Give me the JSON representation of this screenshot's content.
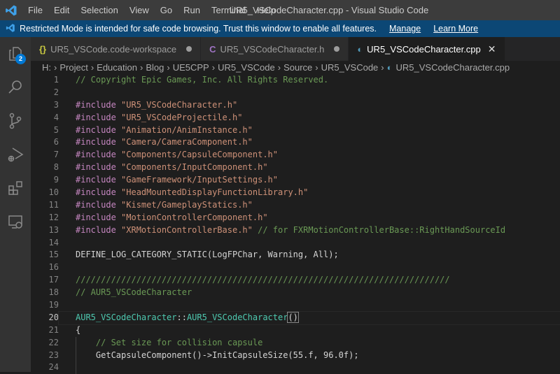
{
  "menu": [
    "File",
    "Edit",
    "Selection",
    "View",
    "Go",
    "Run",
    "Terminal",
    "Help"
  ],
  "window_title": "UR5_VSCodeCharacter.cpp - Visual Studio Code",
  "banner": {
    "text": "Restricted Mode is intended for safe code browsing. Trust this window to enable all features.",
    "manage": "Manage",
    "learn_more": "Learn More"
  },
  "activity": {
    "explorer_badge": "2"
  },
  "tabs": [
    {
      "icon": "{}",
      "label": "UR5_VSCode.code-workspace",
      "dirty": true,
      "color": "#cbcb41"
    },
    {
      "icon": "C",
      "label": "UR5_VSCodeCharacter.h",
      "dirty": true,
      "color": "#a074c4"
    },
    {
      "icon": "G",
      "label": "UR5_VSCodeCharacter.cpp",
      "active": true,
      "color": "#519aba"
    }
  ],
  "breadcrumb": [
    "H:",
    "Project",
    "Education",
    "Blog",
    "UE5CPP",
    "UR5_VSCode",
    "Source",
    "UR5_VSCode",
    "UR5_VSCodeCharacter.cpp"
  ],
  "current_line": 20,
  "code": [
    [
      [
        "c",
        "// Copyright Epic Games, Inc. All Rights Reserved."
      ]
    ],
    [],
    [
      [
        "k",
        "#include "
      ],
      [
        "s",
        "\"UR5_VSCodeCharacter.h\""
      ]
    ],
    [
      [
        "k",
        "#include "
      ],
      [
        "s",
        "\"UR5_VSCodeProjectile.h\""
      ]
    ],
    [
      [
        "k",
        "#include "
      ],
      [
        "s",
        "\"Animation/AnimInstance.h\""
      ]
    ],
    [
      [
        "k",
        "#include "
      ],
      [
        "s",
        "\"Camera/CameraComponent.h\""
      ]
    ],
    [
      [
        "k",
        "#include "
      ],
      [
        "s",
        "\"Components/CapsuleComponent.h\""
      ]
    ],
    [
      [
        "k",
        "#include "
      ],
      [
        "s",
        "\"Components/InputComponent.h\""
      ]
    ],
    [
      [
        "k",
        "#include "
      ],
      [
        "s",
        "\"GameFramework/InputSettings.h\""
      ]
    ],
    [
      [
        "k",
        "#include "
      ],
      [
        "s",
        "\"HeadMountedDisplayFunctionLibrary.h\""
      ]
    ],
    [
      [
        "k",
        "#include "
      ],
      [
        "s",
        "\"Kismet/GameplayStatics.h\""
      ]
    ],
    [
      [
        "k",
        "#include "
      ],
      [
        "s",
        "\"MotionControllerComponent.h\""
      ]
    ],
    [
      [
        "k",
        "#include "
      ],
      [
        "s",
        "\"XRMotionControllerBase.h\""
      ],
      [
        "c",
        " // for FXRMotionControllerBase::RightHandSourceId"
      ]
    ],
    [],
    [
      [
        "p",
        "DEFINE_LOG_CATEGORY_STATIC(LogFPChar, Warning, All);"
      ]
    ],
    [],
    [
      [
        "c",
        "//////////////////////////////////////////////////////////////////////////"
      ]
    ],
    [
      [
        "c",
        "// AUR5_VSCodeCharacter"
      ]
    ],
    [],
    [
      [
        "t",
        "AUR5_VSCodeCharacter"
      ],
      [
        "p",
        "::"
      ],
      [
        "t",
        "AUR5_VSCodeCharacter"
      ],
      [
        "br",
        "()"
      ]
    ],
    [
      [
        "p",
        "{"
      ]
    ],
    [
      [
        "p",
        "    "
      ],
      [
        "c",
        "// Set size for collision capsule"
      ]
    ],
    [
      [
        "p",
        "    GetCapsuleComponent()->InitCapsuleSize(55.f, 96.0f);"
      ]
    ],
    []
  ]
}
